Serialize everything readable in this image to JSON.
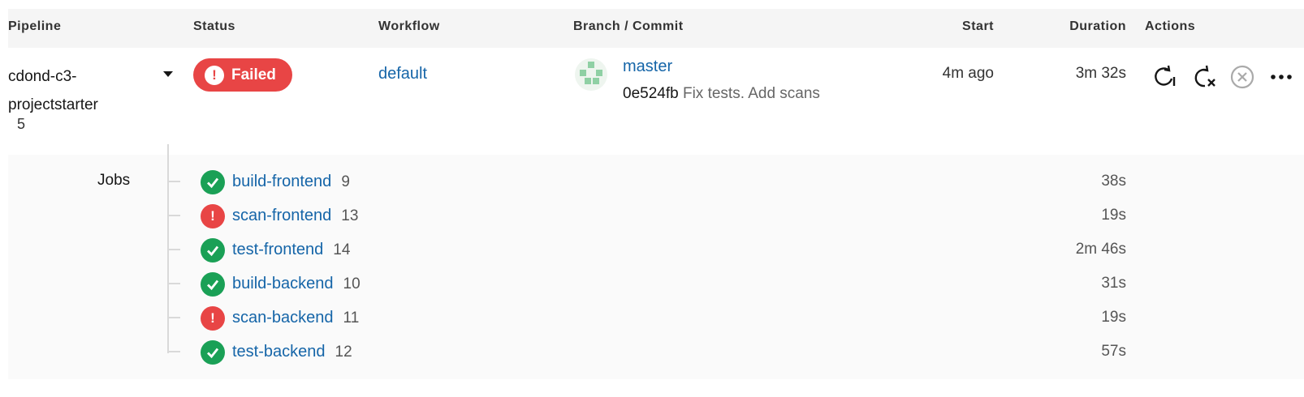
{
  "columns": {
    "pipeline": "Pipeline",
    "status": "Status",
    "workflow": "Workflow",
    "branch_commit": "Branch / Commit",
    "start": "Start",
    "duration": "Duration",
    "actions": "Actions"
  },
  "pipeline": {
    "name": "cdond-c3-projectstarter",
    "number": "5",
    "status": "Failed",
    "workflow": "default",
    "branch": "master",
    "commit_sha": "0e524fb",
    "commit_message": "Fix tests. Add scans",
    "start": "4m ago",
    "duration": "3m 32s"
  },
  "actions_icons": [
    "rerun-icon",
    "rerun-failed-icon",
    "cancel-icon",
    "more-icon"
  ],
  "jobs_label": "Jobs",
  "jobs": [
    {
      "name": "build-frontend",
      "number": "9",
      "status": "success",
      "duration": "38s"
    },
    {
      "name": "scan-frontend",
      "number": "13",
      "status": "failed",
      "duration": "19s"
    },
    {
      "name": "test-frontend",
      "number": "14",
      "status": "success",
      "duration": "2m 46s"
    },
    {
      "name": "build-backend",
      "number": "10",
      "status": "success",
      "duration": "31s"
    },
    {
      "name": "scan-backend",
      "number": "11",
      "status": "failed",
      "duration": "19s"
    },
    {
      "name": "test-backend",
      "number": "12",
      "status": "success",
      "duration": "57s"
    }
  ],
  "colors": {
    "success": "#1aa056",
    "failed": "#e84545",
    "link": "#1565a8",
    "header_bg": "#f5f5f5"
  }
}
